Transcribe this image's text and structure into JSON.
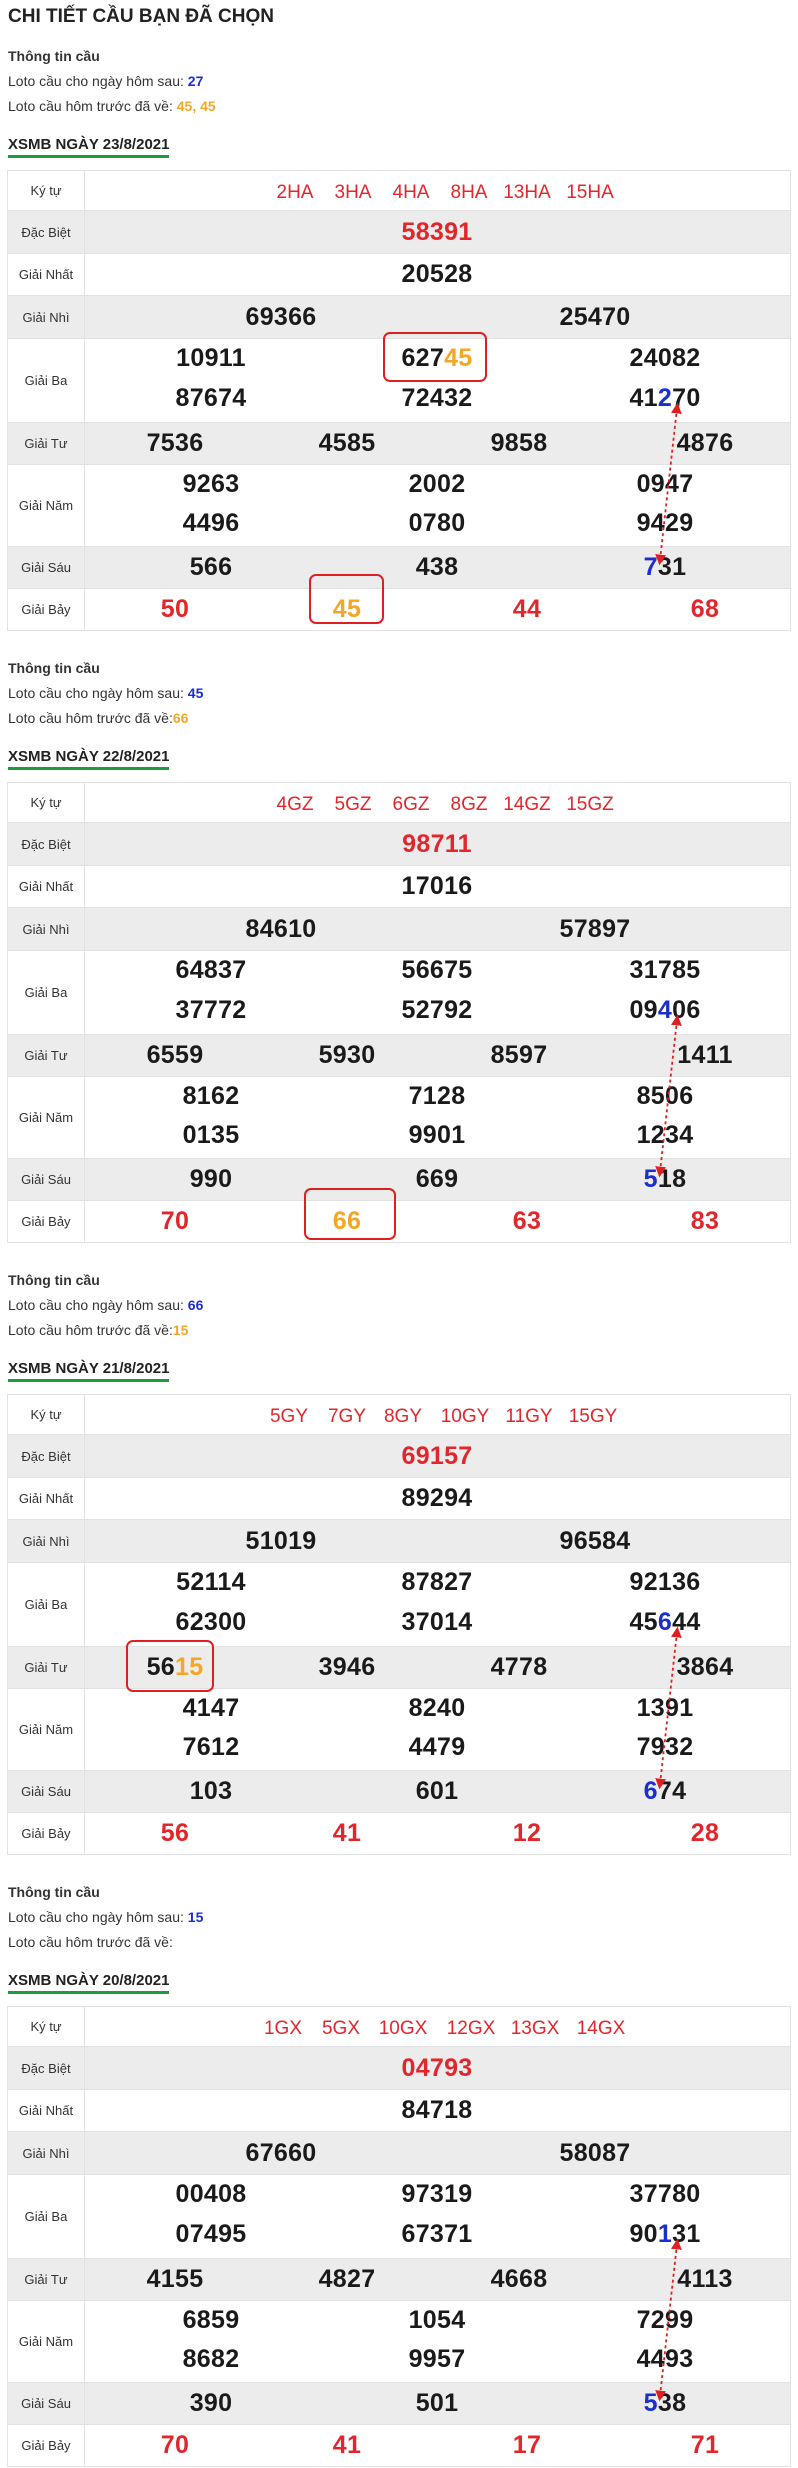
{
  "page": {
    "title": "CHI TIẾT CẦU BẠN ĐÃ CHỌN"
  },
  "labels": {
    "col_kytu": "Ký tự",
    "dac_biet": "Đặc Biệt",
    "giai_nhat": "Giải Nhất",
    "giai_nhi": "Giải Nhì",
    "giai_ba": "Giải Ba",
    "giai_tu": "Giải Tư",
    "giai_nam": "Giải Năm",
    "giai_sau": "Giải Sáu",
    "giai_bay": "Giải Bảy"
  },
  "info_blocks": [
    {
      "title": "Thông tin cầu",
      "next_label": "Loto cầu cho ngày hôm sau: ",
      "next_value": "27",
      "prev_label": "Loto cầu hôm trước đã về: ",
      "prev_value": "45, 45"
    },
    {
      "title": "Thông tin cầu",
      "next_label": "Loto cầu cho ngày hôm sau: ",
      "next_value": "45",
      "prev_label": "Loto cầu hôm trước đã về:",
      "prev_value": "66"
    },
    {
      "title": "Thông tin cầu",
      "next_label": "Loto cầu cho ngày hôm sau: ",
      "next_value": "66",
      "prev_label": "Loto cầu hôm trước đã về:",
      "prev_value": "15"
    },
    {
      "title": "Thông tin cầu",
      "next_label": "Loto cầu cho ngày hôm sau: ",
      "next_value": "15",
      "prev_label": "Loto cầu hôm trước đã về:",
      "prev_value": ""
    }
  ],
  "draws": [
    {
      "title": "XSMB NGÀY 23/8/2021",
      "codes": [
        "2HA",
        "3HA",
        "4HA",
        "8HA",
        "13HA",
        "15HA"
      ],
      "dac_biet": "58391",
      "giai_nhat": "20528",
      "giai_nhi": [
        "69366",
        "25470"
      ],
      "giai_ba": [
        [
          "10911",
          "627",
          "45",
          "",
          "24082"
        ],
        [
          "87674",
          "72432",
          "41",
          "2",
          "70"
        ]
      ],
      "giai_tu": [
        "7536",
        "4585",
        "9858",
        "4876"
      ],
      "giai_nam": [
        [
          "9263",
          "2002",
          "0947"
        ],
        [
          "4496",
          "0780",
          "9429"
        ]
      ],
      "giai_sau": [
        "566",
        "438",
        "7",
        "31"
      ],
      "giai_bay": [
        "50",
        "45",
        "44",
        "68"
      ]
    },
    {
      "title": "XSMB NGÀY 22/8/2021",
      "codes": [
        "4GZ",
        "5GZ",
        "6GZ",
        "8GZ",
        "14GZ",
        "15GZ"
      ],
      "dac_biet": "98711",
      "giai_nhat": "17016",
      "giai_nhi": [
        "84610",
        "57897"
      ],
      "giai_ba": [
        [
          "64837",
          "56675",
          "31785"
        ],
        [
          "37772",
          "52792",
          "09",
          "4",
          "06"
        ]
      ],
      "giai_tu": [
        "6559",
        "5930",
        "8597",
        "1411"
      ],
      "giai_nam": [
        [
          "8162",
          "7128",
          "8506"
        ],
        [
          "0135",
          "9901",
          "1234"
        ]
      ],
      "giai_sau": [
        "990",
        "669",
        "5",
        "18"
      ],
      "giai_bay": [
        "70",
        "66",
        "63",
        "83"
      ]
    },
    {
      "title": "XSMB NGÀY 21/8/2021",
      "codes": [
        "5GY",
        "7GY",
        "8GY",
        "10GY",
        "11GY",
        "15GY"
      ],
      "dac_biet": "69157",
      "giai_nhat": "89294",
      "giai_nhi": [
        "51019",
        "96584"
      ],
      "giai_ba": [
        [
          "52114",
          "87827",
          "92136"
        ],
        [
          "62300",
          "37014",
          "45",
          "6",
          "44"
        ]
      ],
      "giai_tu": [
        "56",
        "15",
        "3946",
        "4778",
        "3864"
      ],
      "giai_nam": [
        [
          "4147",
          "8240",
          "1391"
        ],
        [
          "7612",
          "4479",
          "7932"
        ]
      ],
      "giai_sau": [
        "103",
        "601",
        "6",
        "74"
      ],
      "giai_bay": [
        "56",
        "41",
        "12",
        "28"
      ]
    },
    {
      "title": "XSMB NGÀY 20/8/2021",
      "codes": [
        "1GX",
        "5GX",
        "10GX",
        "12GX",
        "13GX",
        "14GX"
      ],
      "dac_biet": "04793",
      "giai_nhat": "84718",
      "giai_nhi": [
        "67660",
        "58087"
      ],
      "giai_ba": [
        [
          "00408",
          "97319",
          "37780"
        ],
        [
          "07495",
          "67371",
          "90",
          "1",
          "31"
        ]
      ],
      "giai_tu": [
        "4155",
        "4827",
        "4668",
        "4113"
      ],
      "giai_nam": [
        [
          "6859",
          "1054",
          "7299"
        ],
        [
          "8682",
          "9957",
          "4493"
        ]
      ],
      "giai_sau": [
        "390",
        "501",
        "5",
        "38"
      ],
      "giai_bay": [
        "70",
        "41",
        "17",
        "71"
      ]
    }
  ]
}
